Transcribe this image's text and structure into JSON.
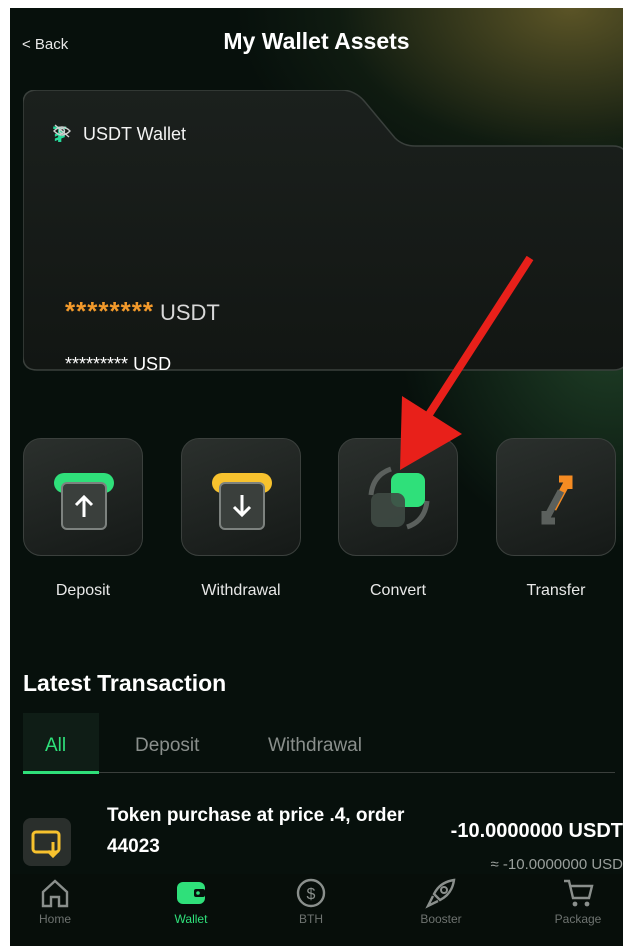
{
  "header": {
    "back_label": "< Back",
    "title": "My Wallet Assets"
  },
  "wallet": {
    "name": "USDT Wallet",
    "balance_masked": "********",
    "balance_unit": "USDT",
    "usd_masked": "*********",
    "usd_unit": "USD"
  },
  "actions": [
    {
      "label": "Deposit"
    },
    {
      "label": "Withdrawal"
    },
    {
      "label": "Convert"
    },
    {
      "label": "Transfer"
    }
  ],
  "transactions": {
    "title": "Latest Transaction",
    "tabs": [
      {
        "label": "All"
      },
      {
        "label": "Deposit"
      },
      {
        "label": "Withdrawal"
      }
    ],
    "items": [
      {
        "description": "Token purchase at price .4, order 44023",
        "amount": "-10.0000000 USDT",
        "amount_usd": "≈ -10.0000000 USD"
      }
    ]
  },
  "nav": [
    {
      "label": "Home",
      "icon": "home-icon"
    },
    {
      "label": "Wallet",
      "icon": "wallet-icon"
    },
    {
      "label": "BTH",
      "icon": "dollar-icon"
    },
    {
      "label": "Booster",
      "icon": "rocket-icon"
    },
    {
      "label": "Package",
      "icon": "cart-icon"
    }
  ],
  "colors": {
    "accent": "#2fe07a",
    "balance": "#f39a2b",
    "annotation": "#e8201a"
  }
}
